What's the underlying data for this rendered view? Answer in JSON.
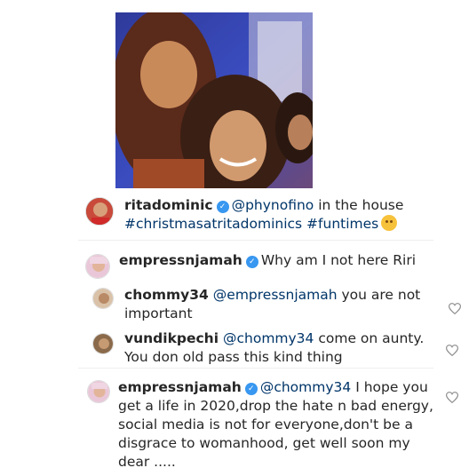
{
  "post": {
    "caption_user": "ritadominic",
    "caption_mention": "@phynofino",
    "caption_text": " in the house",
    "caption_hashtags": "#christmasatritadominics #funtimes"
  },
  "comments": [
    {
      "user": "empressnjamah",
      "verified": true,
      "mention": "",
      "text": "Why am I not here Riri"
    },
    {
      "user": "chommy34",
      "verified": false,
      "mention": "@empressnjamah",
      "text_line1": " you are not",
      "text_line2": "important"
    },
    {
      "user": "vundikpechi",
      "verified": false,
      "mention": "@chommy34",
      "text_line1": " come on aunty.",
      "text_line2": "You don old pass this kind thing"
    },
    {
      "user": "empressnjamah",
      "verified": true,
      "mention": "@chommy34",
      "text_line1": " I hope you",
      "text_line2": "get a life in 2020,drop the hate n bad energy,",
      "text_line3": "social media is not for everyone,don't be a",
      "text_line4": "disgrace to womanhood, get well soon my",
      "text_line5": "dear ....."
    }
  ],
  "icons": {
    "verified": "verified-badge-icon",
    "like": "heart-icon",
    "emoji": "hugging-face-emoji"
  },
  "colors": {
    "verified": "#3897f0",
    "text": "#262626",
    "link": "#003569",
    "icon": "#8e8e8e"
  }
}
